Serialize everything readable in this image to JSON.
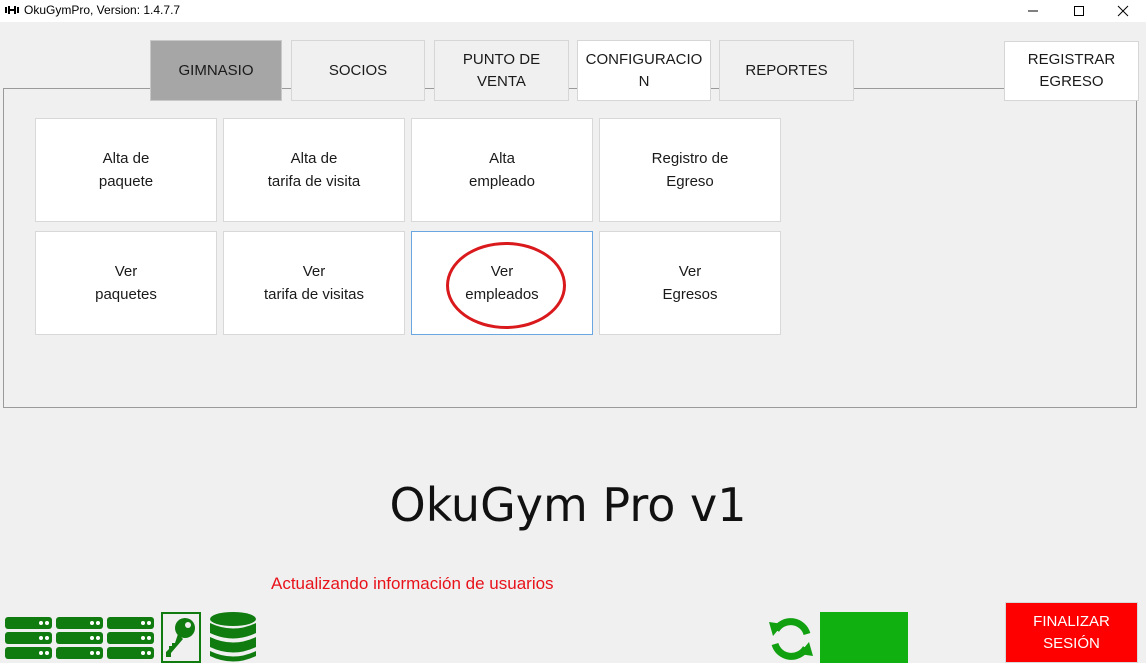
{
  "window": {
    "title": "OkuGymPro, Version: 1.4.7.7",
    "icon": "dumbbell-icon"
  },
  "tabs": [
    {
      "label": "GIMNASIO",
      "active": true
    },
    {
      "label": "SOCIOS"
    },
    {
      "label": "PUNTO DE\nVENTA"
    },
    {
      "label": "CONFIGURACIO\nN"
    },
    {
      "label": "REPORTES"
    }
  ],
  "register_expense_button": "REGISTRAR\nEGRESO",
  "tiles": [
    {
      "label": "Alta de\npaquete"
    },
    {
      "label": "Alta de\ntarifa de visita"
    },
    {
      "label": "Alta\nempleado"
    },
    {
      "label": "Registro de\nEgreso"
    },
    {
      "label": "Ver\npaquetes"
    },
    {
      "label": "Ver\ntarifa de visitas"
    },
    {
      "label": "Ver\nempleados",
      "selected": true
    },
    {
      "label": "Ver\nEgresos"
    }
  ],
  "brand_title": "OkuGym Pro v1",
  "status_message": "Actualizando información de usuarios",
  "logout_button": "FINALIZAR\nSESIÓN",
  "colors": {
    "accent_green": "#107c10",
    "logout_red": "#ff0000",
    "status_red": "#e8121b",
    "highlight_circle": "#d9191c"
  }
}
